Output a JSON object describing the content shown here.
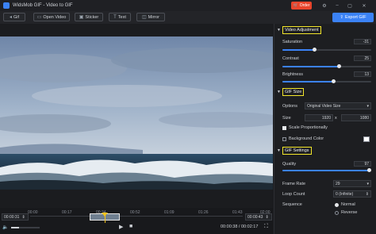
{
  "app": {
    "title": "WidsMob GIF - Video to GIF",
    "order_label": "Order"
  },
  "window_controls": {
    "settings": "⚙",
    "minimize": "–",
    "maximize": "▢",
    "close": "✕"
  },
  "toolbar": {
    "back_label": "Gif",
    "open_video_label": "Open Video",
    "sticker_label": "Sticker",
    "text_label": "Text",
    "mirror_label": "Mirror",
    "export_label": "Export GIF"
  },
  "timeline": {
    "ticks": [
      "00:00",
      "00:17",
      "00:34",
      "00:52",
      "01:09",
      "01:26",
      "01:43",
      "02:00"
    ],
    "start_time": "00:00:31",
    "end_time": "00:00:43",
    "timecode": "00:00:38 / 00:02:17",
    "progress": 0.28
  },
  "panel": {
    "video_adjustment": {
      "title": "Video Adjustment",
      "saturation_label": "Saturation",
      "saturation_value": "-31",
      "saturation_level": 0.36,
      "contrast_label": "Contrast",
      "contrast_value": "25",
      "contrast_level": 0.63,
      "brightness_label": "Brightness",
      "brightness_value": "13",
      "brightness_level": 0.57
    },
    "gif_size": {
      "title": "GIF Size",
      "options_label": "Options",
      "options_value": "Original Video Size",
      "size_label": "Size",
      "width": "1920",
      "times": "x",
      "height": "1080",
      "scale_label": "Scale Proportionally",
      "bg_label": "Background Color"
    },
    "gif_settings": {
      "title": "GIF Settings",
      "quality_label": "Quality",
      "quality_value": "97",
      "quality_level": 0.97,
      "frame_rate_label": "Frame Rate",
      "frame_rate_value": "29",
      "loop_count_label": "Loop Count",
      "loop_count_value": "0 (Infinite)",
      "sequence_label": "Sequence",
      "sequence_normal": "Normal",
      "sequence_reverse": "Reverse"
    }
  },
  "colors": {
    "accent": "#3b82f6",
    "order": "#e8452c",
    "highlight": "#f4e72b",
    "playhead": "#f3c31b"
  }
}
